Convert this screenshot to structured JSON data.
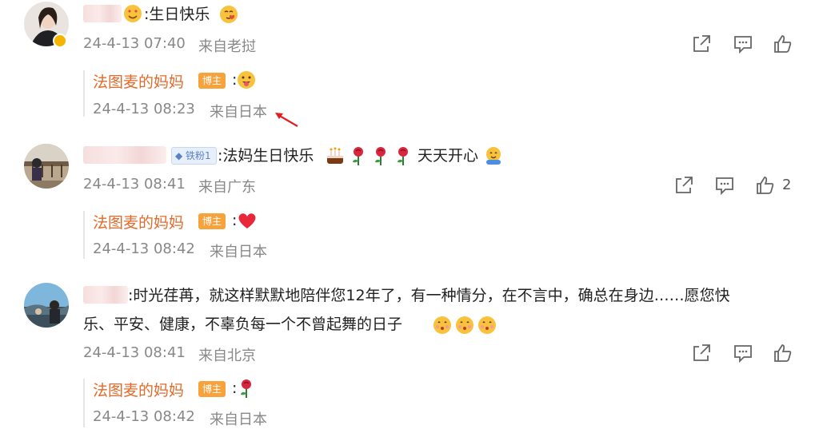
{
  "comments": [
    {
      "text": ":生日快乐",
      "time": "24-4-13 07:40",
      "source": "来自老挝",
      "reply": {
        "author": "法图麦的妈妈",
        "badge": "博主",
        "text": ":",
        "time": "24-4-13 08:23",
        "source": "来自日本"
      }
    },
    {
      "fan_badge": "铁粉1",
      "text": ":法妈生日快乐",
      "text2": "天天开心",
      "time": "24-4-13 08:41",
      "source": "来自广东",
      "likes": "2",
      "reply": {
        "author": "法图麦的妈妈",
        "badge": "博主",
        "text": ":",
        "time": "24-4-13 08:42",
        "source": "来自日本"
      }
    },
    {
      "text_line1": ":时光荏苒，就这样默默地陪伴您12年了，有一种情分，在不言中，确总在身边……愿您快",
      "text_line2": "乐、平安、健康，不辜负每一个不曾起舞的日子",
      "time": "24-4-13 08:41",
      "source": "来自北京",
      "reply": {
        "author": "法图麦的妈妈",
        "badge": "博主",
        "text": ":",
        "time": "24-4-13 08:42",
        "source": "来自日本"
      }
    }
  ],
  "colors": {
    "author": "#e36a2a",
    "badge": "#f7a23b",
    "meta": "#888888",
    "annotation_arrow": "#e02020"
  }
}
